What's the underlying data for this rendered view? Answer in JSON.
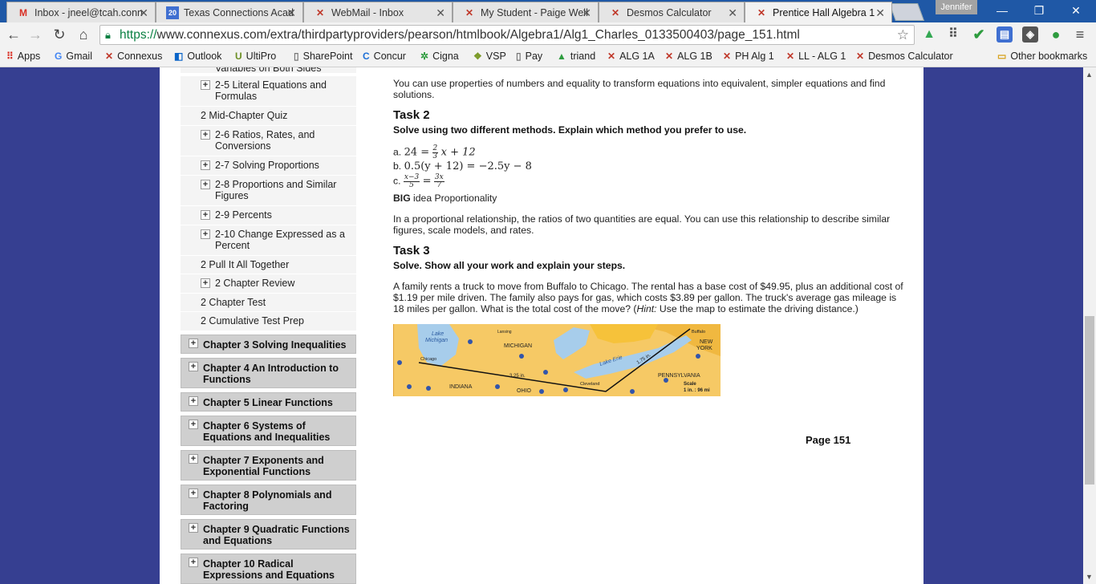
{
  "tabs": [
    {
      "label": "Inbox - jneel@tcah.conn",
      "icon": "gmail-icon"
    },
    {
      "label": "Texas Connections Acad",
      "icon": "calendar-icon",
      "icon_text": "20"
    },
    {
      "label": "WebMail - Inbox",
      "icon": "desmos-icon"
    },
    {
      "label": "My Student - Paige Well",
      "icon": "desmos-icon"
    },
    {
      "label": "Desmos Calculator",
      "icon": "desmos-icon"
    },
    {
      "label": "Prentice Hall Algebra 1",
      "icon": "desmos-icon",
      "active": true
    }
  ],
  "profile_name": "Jennifer",
  "address": {
    "scheme": "https://",
    "rest": "www.connexus.com/extra/thirdpartyproviders/pearson/htmlbook/Algebra1/Alg1_Charles_0133500403/page_151.html"
  },
  "bookmarks": [
    {
      "label": "Apps",
      "icon": "apps-grid-icon"
    },
    {
      "label": "Gmail",
      "icon": "google-icon"
    },
    {
      "label": "Connexus",
      "icon": "desmos-icon"
    },
    {
      "label": "Outlook",
      "icon": "outlook-icon"
    },
    {
      "label": "UltiPro",
      "icon": "ultipro-icon"
    },
    {
      "label": "SharePoint",
      "icon": "page-icon"
    },
    {
      "label": "Concur",
      "icon": "concur-icon"
    },
    {
      "label": "Cigna",
      "icon": "cigna-icon"
    },
    {
      "label": "VSP",
      "icon": "vsp-icon"
    },
    {
      "label": "Pay",
      "icon": "page-icon"
    },
    {
      "label": "triand",
      "icon": "triangle-icon"
    },
    {
      "label": "ALG 1A",
      "icon": "desmos-icon"
    },
    {
      "label": "ALG 1B",
      "icon": "desmos-icon"
    },
    {
      "label": "PH Alg 1",
      "icon": "desmos-icon"
    },
    {
      "label": "LL - ALG 1",
      "icon": "desmos-icon"
    },
    {
      "label": "Desmos Calculator",
      "icon": "desmos-icon"
    }
  ],
  "other_bookmarks": "Other bookmarks",
  "sidebar": {
    "cut_top_label": "Variables on Both Sides",
    "sub_items": [
      {
        "label": "2-5 Literal Equations and Formulas",
        "plus": true
      },
      {
        "label": "2 Mid-Chapter Quiz",
        "plus": false
      },
      {
        "label": "2-6 Ratios, Rates, and Conversions",
        "plus": true
      },
      {
        "label": "2-7 Solving Proportions",
        "plus": true
      },
      {
        "label": "2-8 Proportions and Similar Figures",
        "plus": true
      },
      {
        "label": "2-9 Percents",
        "plus": true
      },
      {
        "label": "2-10 Change Expressed as a Percent",
        "plus": true
      },
      {
        "label": "2 Pull It All Together",
        "plus": false
      },
      {
        "label": "2 Chapter Review",
        "plus": true
      },
      {
        "label": "2 Chapter Test",
        "plus": false
      },
      {
        "label": "2 Cumulative Test Prep",
        "plus": false
      }
    ],
    "chapters": [
      "Chapter 3 Solving Inequalities",
      "Chapter 4 An Introduction to Functions",
      "Chapter 5 Linear Functions",
      "Chapter 6 Systems of Equations and Inequalities",
      "Chapter 7 Exponents and Exponential Functions",
      "Chapter 8 Polynomials and Factoring",
      "Chapter 9 Quadratic Functions and Equations",
      "Chapter 10 Radical Expressions and Equations"
    ]
  },
  "main": {
    "intro": "You can use properties of numbers and equality to transform equations into equivalent, simpler equations and find solutions.",
    "task2": {
      "title": "Task 2",
      "subtitle": "Solve using two different methods. Explain which method you prefer to use.",
      "a_prefix": "a.",
      "a_left": "24 =",
      "a_frac_num": "2",
      "a_frac_den": "3",
      "a_right": "x + 12",
      "b_prefix": "b.",
      "b_expr": "0.5(y + 12) = −2.5y − 8",
      "c_prefix": "c.",
      "c_frac1_num": "x−3",
      "c_frac1_den": "5",
      "c_eq": "=",
      "c_frac2_num": "3x",
      "c_frac2_den": "7"
    },
    "big_idea": {
      "big": "BIG",
      "rest": " idea Proportionality"
    },
    "proportional": "In a proportional relationship, the ratios of two quantities are equal. You can use this relationship to describe similar figures, scale models, and rates.",
    "task3": {
      "title": "Task 3",
      "subtitle": "Solve. Show all your work and explain your steps.",
      "problem_a": "A family rents a truck to move from Buffalo to Chicago. The rental has a base cost of $49.95, plus an additional cost of $1.19 per mile driven. The family also pays for gas, which costs $3.89 per gallon. The truck's average gas mileage is 18 miles per gallon. What is the total cost of the move? (",
      "hint_label": "Hint:",
      "problem_b": " Use the map to estimate the driving distance.)"
    },
    "map": {
      "labels": {
        "lake_michigan_1": "Lake",
        "lake_michigan_2": "Michigan",
        "lansing": "Lansing",
        "michigan": "MICHIGAN",
        "chicago": "Chicago",
        "buffalo": "Buffalo",
        "new_york_1": "NEW",
        "new_york_2": "YORK",
        "lake_erie": "Lake Erie",
        "dist1": "1.75 in.",
        "dist2": "3.25 in.",
        "indiana": "INDIANA",
        "ohio": "OHIO",
        "cleveland": "Cleveland",
        "pennsylvania": "PENNSYLVANIA",
        "scale_1": "Scale",
        "scale_2": "1 in. : 96 mi"
      }
    },
    "page_label": "Page 151"
  }
}
